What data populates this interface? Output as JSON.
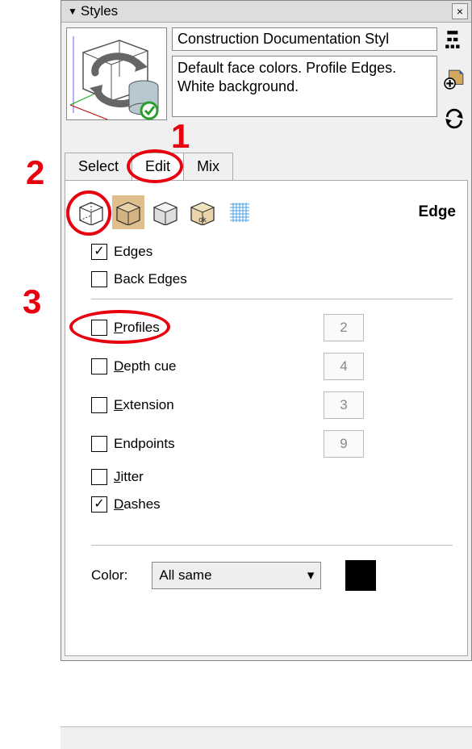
{
  "panel": {
    "title": "Styles",
    "style_name": "Construction Documentation Styl",
    "style_desc": "Default face colors. Profile Edges. White background."
  },
  "tabs": {
    "select": "Select",
    "edit": "Edit",
    "mix": "Mix"
  },
  "edge_section": {
    "heading": "Edge"
  },
  "options": {
    "edges": {
      "label": "Edges",
      "checked": true
    },
    "back_edges": {
      "label": "Back Edges",
      "checked": false
    },
    "profiles": {
      "label": "Profiles",
      "value": "2",
      "checked": false,
      "ul": "P",
      "rest": "rofiles"
    },
    "depth_cue": {
      "label": "Depth cue",
      "value": "4",
      "checked": false,
      "ul": "D",
      "rest": "epth cue"
    },
    "extension": {
      "label": "Extension",
      "value": "3",
      "checked": false,
      "ul": "E",
      "rest": "xtension"
    },
    "endpoints": {
      "label": "Endpoints",
      "value": "9",
      "checked": false
    },
    "jitter": {
      "label": "Jitter",
      "checked": false,
      "ul": "J",
      "rest": "itter"
    },
    "dashes": {
      "label": "Dashes",
      "checked": true,
      "ul": "D",
      "rest": "ashes"
    }
  },
  "color": {
    "label": "Color:",
    "value": "All same",
    "swatch": "#000000"
  },
  "annotations": {
    "a1": "1",
    "a2": "2",
    "a3": "3"
  }
}
